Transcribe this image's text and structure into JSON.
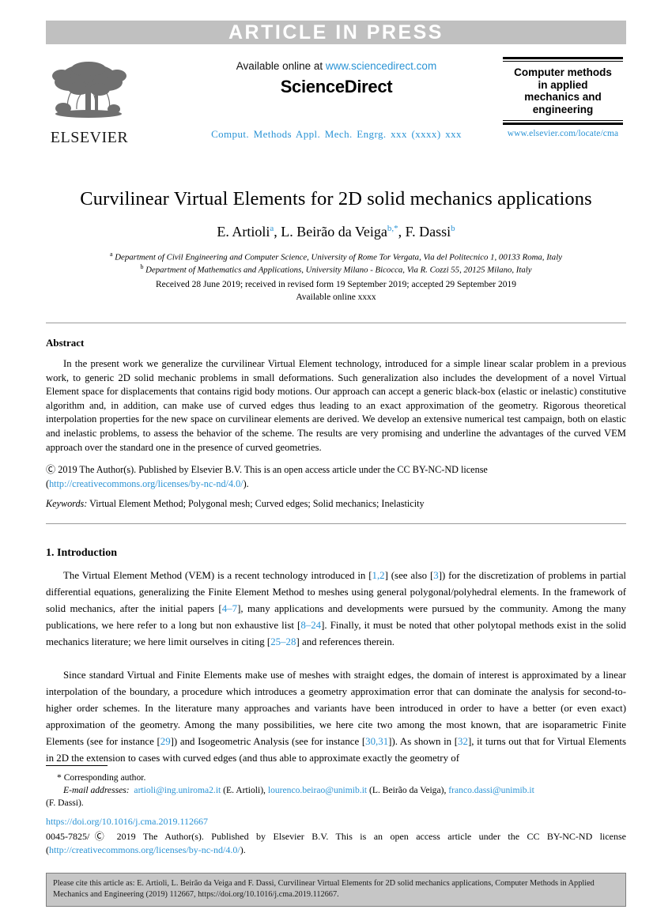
{
  "banner": {
    "label": "ARTICLE IN PRESS"
  },
  "masthead": {
    "publisher_name": "ELSEVIER",
    "publisher_logo_icon": "elsevier-tree-logo",
    "available_prefix": "Available online at ",
    "sciencedirect_url": "www.sciencedirect.com",
    "sciencedirect_wordmark": "ScienceDirect",
    "journal_reference": "Comput. Methods Appl. Mech. Engrg. xxx (xxxx) xxx",
    "journal_title": "Computer methods in applied mechanics and engineering",
    "journal_title_lines": [
      "Computer methods",
      "in applied",
      "mechanics and",
      "engineering"
    ],
    "journal_url": "www.elsevier.com/locate/cma"
  },
  "article": {
    "title": "Curvilinear Virtual Elements for 2D solid mechanics applications",
    "authors_html": "E. Artioli<sup>a</sup>, L. Beirão da Veiga<sup>b,*</sup>, F. Dassi<sup>b</sup>",
    "affiliation_a": "Department of Civil Engineering and Computer Science, University of Rome Tor Vergata, Via del Politecnico 1, 00133 Roma, Italy",
    "affiliation_b": "Department of Mathematics and Applications, University Milano - Bicocca, Via R. Cozzi 55, 20125 Milano, Italy",
    "received_line": "Received 28 June 2019; received in revised form 19 September 2019; accepted 29 September 2019",
    "available_online_line": "Available online  xxxx"
  },
  "abstract": {
    "heading": "Abstract",
    "body": "In the present work we generalize the curvilinear Virtual Element technology, introduced for a simple linear scalar problem in a previous work, to generic 2D solid mechanic problems in small deformations. Such generalization also includes the development of a novel Virtual Element space for displacements that contains rigid body motions. Our approach can accept a generic black-box (elastic or inelastic) constitutive algorithm and, in addition, can make use of curved edges thus leading to an exact approximation of the geometry. Rigorous theoretical interpolation properties for the new space on curvilinear elements are derived. We develop an extensive numerical test campaign, both on elastic and inelastic problems, to assess the behavior of the scheme. The results are very promising and underline the advantages of the curved VEM approach over the standard one in the presence of curved geometries.",
    "copyright_line": "Ⓒ 2019 The Author(s). Published by Elsevier B.V. This is an open access article under the CC BY-NC-ND license",
    "license_open_paren": "(",
    "license_url": "http://creativecommons.org/licenses/by-nc-nd/4.0/",
    "license_close_paren": ").",
    "keywords_label": "Keywords:",
    "keywords_value": " Virtual Element Method; Polygonal mesh; Curved edges; Solid mechanics; Inelasticity"
  },
  "section": {
    "heading": "1.  Introduction",
    "paragraph_1_html": "The Virtual Element Method (VEM) is a recent technology introduced in [<span class=\"cite\">1,2</span>] (see also [<span class=\"cite\">3</span>]) for the discretization of problems in partial differential equations, generalizing the Finite Element Method to meshes using general polygonal/polyhedral elements. In the framework of solid mechanics, after the initial papers [<span class=\"cite\">4–7</span>], many applications and developments were pursued by the community. Among the many publications, we here refer to a long but non exhaustive list [<span class=\"cite\">8–24</span>]. Finally, it must be noted that other polytopal methods exist in the solid mechanics literature; we here limit ourselves in citing [<span class=\"cite\">25–28</span>] and references therein.",
    "paragraph_2_html": "Since standard Virtual and Finite Elements make use of meshes with straight edges, the domain of interest is approximated by a linear interpolation of the boundary, a procedure which introduces a geometry approximation error that can dominate the analysis for second-to-higher order schemes. In the literature many approaches and variants have been introduced in order to have a better (or even exact) approximation of the geometry. Among the many possibilities, we here cite two among the most known, that are isoparametric Finite Elements (see for instance [<span class=\"cite\">29</span>]) and Isogeometric Analysis (see for instance [<span class=\"cite\">30,31</span>]). As shown in [<span class=\"cite\">32</span>], it turns out that for Virtual Elements in 2D the extension to cases with curved edges (and thus able to approximate exactly the geometry of"
  },
  "footnote": {
    "corresponding_author": "*  Corresponding author.",
    "email_label": "E-mail addresses:",
    "emails_html": " &nbsp;<span class=\"mail\">artioli@ing.uniroma2.it</span> (E. Artioli), <span class=\"mail\">lourenco.beirao@unimib.it</span> (L. Beirão da Veiga), <span class=\"mail\">franco.dassi@unimib.it</span>",
    "emails_tail": "(F. Dassi)."
  },
  "bottom": {
    "doi": "https://doi.org/10.1016/j.cma.2019.112667",
    "issn_line": "0045-7825/Ⓒ 2019 The Author(s).  Published by Elsevier B.V. This is an open access article under the CC BY-NC-ND license",
    "license_open_paren": "(",
    "license_url": "http://creativecommons.org/licenses/by-nc-nd/4.0/",
    "license_close_paren": ")."
  },
  "cite_box": {
    "text": "Please cite this article as: E. Artioli, L. Beirão da Veiga and F. Dassi, Curvilinear Virtual Elements for 2D solid mechanics applications, Computer Methods in Applied Mechanics and Engineering (2019) 112667, https://doi.org/10.1016/j.cma.2019.112667."
  },
  "colors": {
    "link_blue": "#2a93d5",
    "banner_gray": "#c0c0c0",
    "cite_box_gray": "#c6c6c6"
  }
}
